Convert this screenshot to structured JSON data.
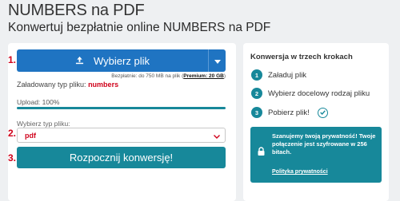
{
  "header": {
    "title": "NUMBERS na PDF",
    "subtitle": "Konwertuj bezpłatnie online NUMBERS na PDF"
  },
  "main": {
    "step_markers": [
      "1.",
      "2.",
      "3."
    ],
    "choose_file_label": "Wybierz plik",
    "limit_note_prefix": "Bezpłatnie: do 750 MB na plik (",
    "limit_note_premium": "Premium: 20 GB",
    "limit_note_suffix": ")",
    "loaded_type_label": "Załadowany typ pliku:",
    "loaded_type_value": "numbers",
    "upload_label": "Upload: 100%",
    "upload_progress": 1.0,
    "select_label": "Wybierz typ pliku:",
    "select_value": "pdf",
    "convert_label": "Rozpocznij konwersję!"
  },
  "sidebar": {
    "title": "Konwersja w trzech krokach",
    "steps": [
      {
        "num": "1",
        "label": "Załaduj plik"
      },
      {
        "num": "2",
        "label": "Wybierz docelowy rodzaj pliku"
      },
      {
        "num": "3",
        "label": "Pobierz plik!"
      }
    ],
    "privacy_text": "Szanujemy twoją prywatność! Twoje połączenie jest szyfrowane w 256 bitach.",
    "privacy_link": "Polityka prywatności"
  },
  "colors": {
    "primary_blue": "#1f74c2",
    "teal": "#17889a",
    "accent_red": "#d0021b"
  }
}
